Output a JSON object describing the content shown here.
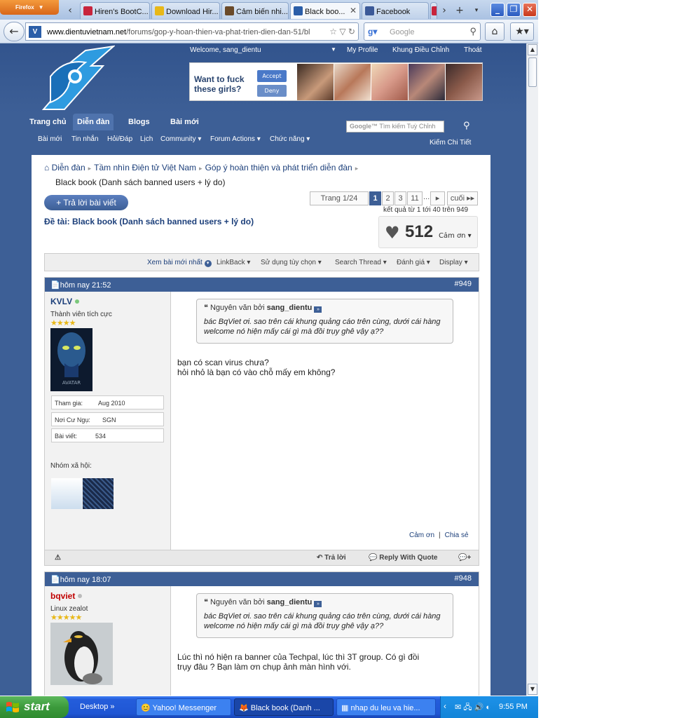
{
  "browser": {
    "app_button": "Firefox",
    "tabs": [
      {
        "label": "Hiren's BootC...",
        "icon_color": "#c8243c"
      },
      {
        "label": "Download Hir...",
        "icon_color": "#e8b818"
      },
      {
        "label": "Cảm biến nhi...",
        "icon_color": "#6a4a2a"
      },
      {
        "label": "Black boo...",
        "icon_color": "#2b5ea8"
      },
      {
        "label": "Facebook",
        "icon_color": "#3b5998"
      }
    ],
    "url_domain": "www.dientuvietnam.net",
    "url_path": "/forums/gop-y-hoan-thien-va-phat-trien-dien-dan-51/bl",
    "search_placeholder": "Google"
  },
  "site": {
    "welcome": "Welcome,  sang_dientu",
    "toplinks": [
      "My Profile",
      "Khung Điều Chỉnh",
      "Thoát"
    ],
    "ad_text_1": "Want to fuck",
    "ad_text_2": "these girls?",
    "ad_accept": "Accept",
    "ad_deny": "Deny",
    "nav": [
      "Trang chủ",
      "Diễn đàn",
      "Blogs",
      "Bài mới"
    ],
    "subnav": [
      "Bài mới",
      "Tin nhắn",
      "Hỏi/Đáp",
      "Lịch",
      "Community ▾",
      "Forum Actions ▾",
      "Chức năng ▾"
    ],
    "search_placeholder": "Tìm kiếm Tuỳ Chỉnh",
    "search_brand": "Google™",
    "advanced_search": "Kiếm Chi Tiết"
  },
  "thread": {
    "breadcrumb": [
      "Diễn đàn",
      "Tầm nhìn Điện tử Việt Nam",
      "Góp ý hoàn thiện và phát triển diễn đàn"
    ],
    "breadcrumb_current": "Black book (Danh sách banned users + lý do)",
    "reply_button": "+ Trả lời bài viết",
    "pager": {
      "label": "Trang 1/24",
      "pages": [
        "1",
        "2",
        "3",
        "11"
      ],
      "ellipsis": "...",
      "next": "▸",
      "last": "cuối ▸▸"
    },
    "results": "kết quả từ 1 tới 40 trên 949",
    "title": "Đề tài: Black book (Danh sách banned users + lý do)",
    "thanks_count": "512",
    "thanks_label": "Cảm ơn ▾",
    "toolbar": [
      "Xem bài mới nhất",
      "LinkBack ▾",
      "Sử dụng tùy chọn ▾",
      "Search Thread ▾",
      "Đánh giá ▾",
      "Display ▾"
    ]
  },
  "posts": [
    {
      "date": "hôm nay 21:52",
      "number": "#949",
      "username": "KVLV",
      "user_color": "#1c3f7a",
      "online": true,
      "user_title": "Thành viên tích cực",
      "stars": "★★★★",
      "avatar_caption": "AVATAR",
      "join_label": "Tham gia:",
      "join_value": "Aug 2010",
      "loc_label": "Nơi Cư Ngụ:",
      "loc_value": "SGN",
      "posts_label": "Bài viết:",
      "posts_value": "534",
      "social_label": "Nhóm xã hội:",
      "quote_prefix": "Nguyên văn bởi",
      "quote_author": "sang_dientu",
      "quote_text": "bác BqViet ơi. sao trên cái khung quảng cáo trên cùng, dưới cái hàng welcome nó hiện mấy cái gì mà đồi trụy ghê vậy ạ??",
      "body_1": "bạn có scan virus chưa?",
      "body_2": "hỏi nhỏ là bạn có vào chỗ mấy em không?",
      "thank": "Cảm ơn",
      "share": "Chia sẻ",
      "reply": "Trả lời",
      "reply_quote": "Reply With Quote"
    },
    {
      "date": "hôm nay 18:07",
      "number": "#948",
      "username": "bqviet",
      "user_color": "#c00000",
      "online": false,
      "user_title": "Linux zealot",
      "stars": "★★★★★",
      "quote_prefix": "Nguyên văn bởi",
      "quote_author": "sang_dientu",
      "quote_text": "bác BqViet ơi. sao trên cái khung quảng cáo trên cùng, dưới cái hàng welcome nó hiện mấy cái gì mà đồi trụy ghê vậy ạ??",
      "body_1": "Lúc thì nó hiện ra banner của Techpal, lúc thì 3T group. Có gì đồi",
      "body_2": "trụy đâu ? Bạn làm ơn chụp ảnh màn hình với."
    }
  ],
  "taskbar": {
    "start": "start",
    "tasks": [
      "Desktop",
      "Yahoo! Messenger",
      "Black book (Danh ...",
      "nhap du leu va hie..."
    ],
    "clock": "9:55 PM"
  }
}
